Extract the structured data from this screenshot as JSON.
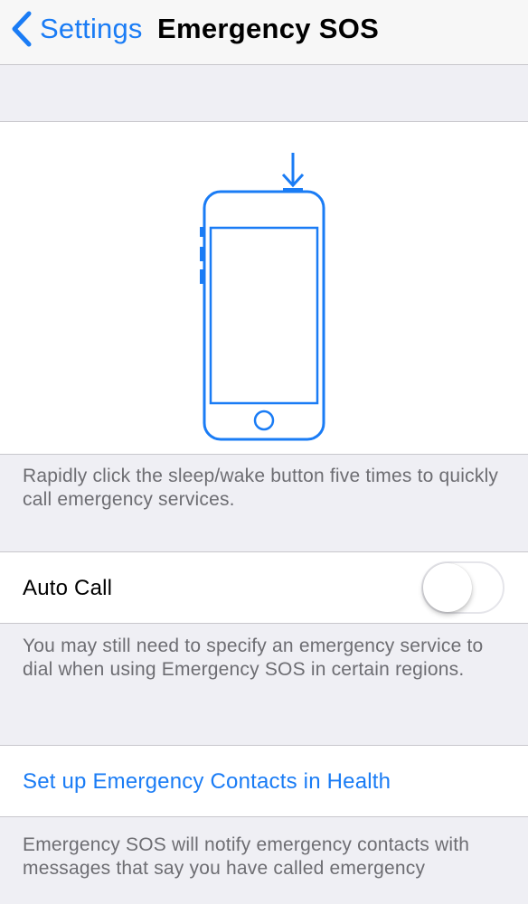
{
  "nav": {
    "back_label": "Settings",
    "title": "Emergency SOS"
  },
  "illustration": {
    "icon": "phone-sleep-wake-icon"
  },
  "sos_description": "Rapidly click the sleep/wake button five times to quickly call emergency services.",
  "auto_call": {
    "label": "Auto Call",
    "enabled": false
  },
  "auto_call_footer": "You may still need to specify an emergency service to dial when using Emergency SOS in certain regions.",
  "emergency_contacts": {
    "link_label": "Set up Emergency Contacts in Health"
  },
  "contacts_footer": "Emergency SOS will notify emergency contacts with messages that say you have called emergency",
  "colors": {
    "accent": "#1a7cf5",
    "background": "#efeff4",
    "secondary_text": "#6d6d72"
  }
}
